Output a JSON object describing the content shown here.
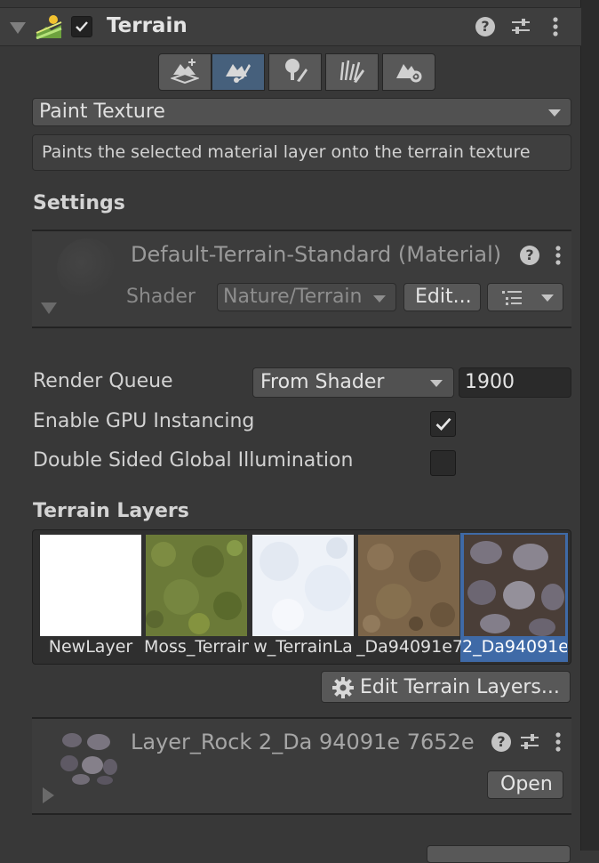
{
  "component": {
    "title": "Terrain",
    "enabled": true
  },
  "toolbar": {
    "buttons": [
      {
        "name": "create-neighbor-terrains",
        "icon": "terrain-add-icon",
        "active": false
      },
      {
        "name": "paint-terrain",
        "icon": "paint-brush-terrain-icon",
        "active": true
      },
      {
        "name": "paint-trees",
        "icon": "tree-brush-icon",
        "active": false
      },
      {
        "name": "paint-details",
        "icon": "grass-brush-icon",
        "active": false
      },
      {
        "name": "terrain-settings",
        "icon": "terrain-gear-icon",
        "active": false
      }
    ]
  },
  "tool_select": {
    "value": "Paint Texture"
  },
  "tool_description": "Paints the selected material layer onto the terrain texture",
  "settings_label": "Settings",
  "material": {
    "name": "Default-Terrain-Standard (Material)",
    "shader_label": "Shader",
    "shader_value": "Nature/Terrain",
    "edit_label": "Edit..."
  },
  "render_queue": {
    "label": "Render Queue",
    "mode": "From Shader",
    "value": "1900"
  },
  "gpu_instancing": {
    "label": "Enable GPU Instancing",
    "checked": true
  },
  "double_sided_gi": {
    "label": "Double Sided Global Illumination",
    "checked": false
  },
  "terrain_layers": {
    "heading": "Terrain Layers",
    "layers": [
      {
        "label": "NewLayer",
        "selected": false
      },
      {
        "label": "Moss_TerrainLayer",
        "selected": false
      },
      {
        "label": "w_TerrainLa",
        "selected": false
      },
      {
        "label": "_Da94091e7",
        "selected": false
      },
      {
        "label": "2_Da94091e",
        "selected": true
      }
    ],
    "edit_button": "Edit Terrain Layers..."
  },
  "layer_asset": {
    "name": "Layer_Rock 2_Da 94091e 7652e",
    "open_label": "Open"
  },
  "colors": {
    "background": "#383838",
    "selected_tool": "#46607c",
    "selected_layer": "#3f6aa7"
  }
}
